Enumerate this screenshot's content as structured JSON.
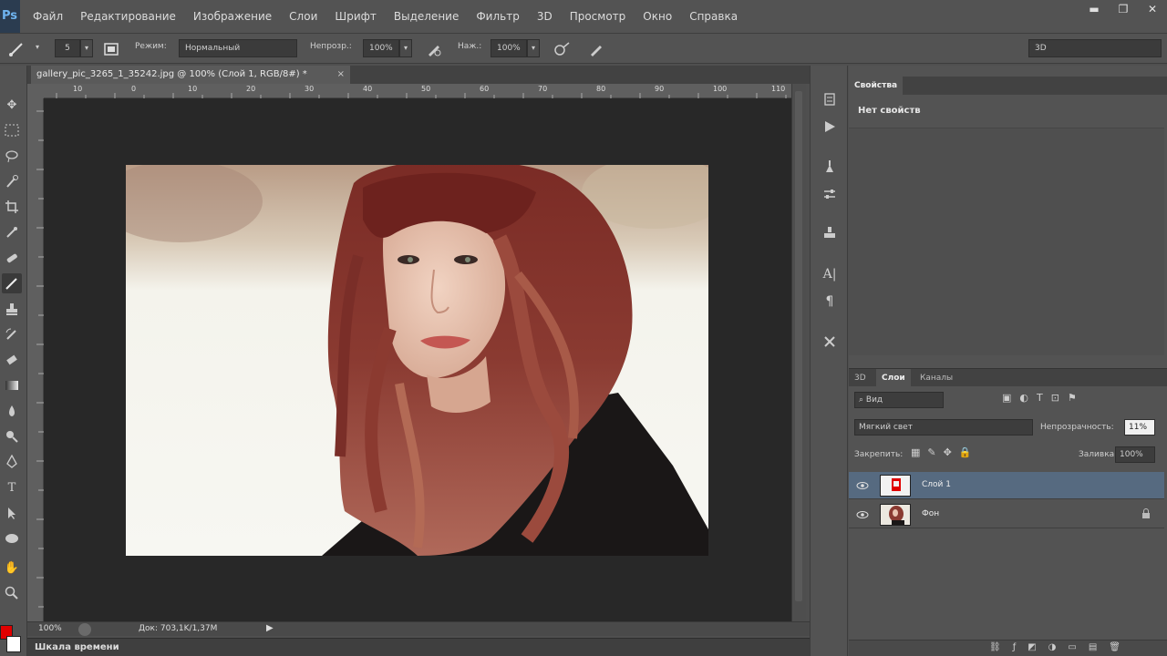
{
  "app": {
    "logo": "Ps"
  },
  "menu": {
    "items": [
      "Файл",
      "Редактирование",
      "Изображение",
      "Слои",
      "Шрифт",
      "Выделение",
      "Фильтр",
      "3D",
      "Просмотр",
      "Окно",
      "Справка"
    ]
  },
  "window_controls": {
    "minimize": "▬",
    "restore": "❐",
    "close": "✕"
  },
  "options": {
    "brush_size": "5",
    "mode_label": "Режим:",
    "mode_value": "Нормальный",
    "opacity_label": "Непрозр.:",
    "opacity_value": "100%",
    "pressure_label": "Наж.:",
    "pressure_value": "100%",
    "workspace": "3D"
  },
  "document": {
    "tab_title": "gallery_pic_3265_1_35242.jpg @ 100% (Слой 1, RGB/8#) *",
    "close": "×",
    "ruler_numbers": [
      "10",
      "0",
      "10",
      "20",
      "30",
      "40",
      "50",
      "60",
      "70",
      "80",
      "90",
      "100",
      "110"
    ],
    "zoom": "100%",
    "doc_info": "Док: 703,1K/1,37M",
    "timeline_label": "Шкала времени"
  },
  "properties": {
    "tab": "Свойства",
    "no_props": "Нет свойств"
  },
  "layers": {
    "tabs": [
      "3D",
      "Слои",
      "Каналы"
    ],
    "filter_kind": "Вид",
    "blend_mode": "Мягкий свет",
    "opacity_label": "Непрозрачность:",
    "opacity_value": "11%",
    "lock_label": "Закрепить:",
    "fill_label": "Заливка:",
    "fill_value": "100%",
    "items": [
      {
        "name": "Слой 1",
        "selected": true
      },
      {
        "name": "Фон",
        "selected": false
      }
    ]
  },
  "colors": {
    "foreground": "#e00000",
    "background": "#ffffff",
    "selected_layer": "#566a80"
  }
}
